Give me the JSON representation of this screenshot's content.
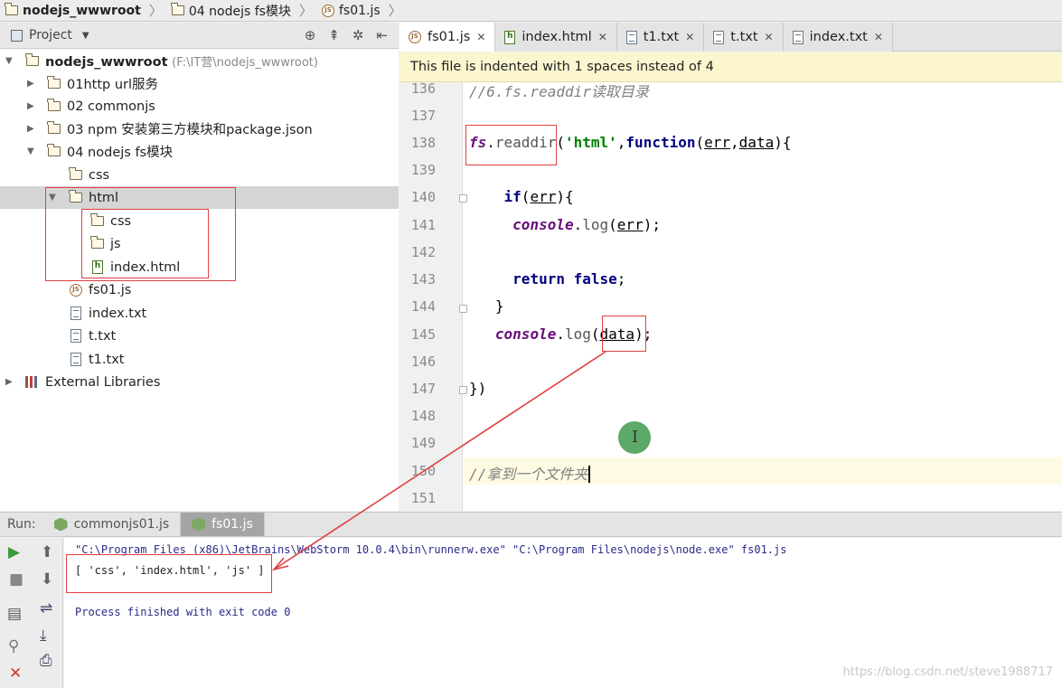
{
  "breadcrumb": [
    "nodejs_wwwroot",
    "04 nodejs fs模块",
    "fs01.js"
  ],
  "project_panel": {
    "title": "Project",
    "root_label": "nodejs_wwwroot",
    "root_path": "(F:\\IT营\\nodejs_wwwroot)",
    "items": [
      "01http url服务",
      "02 commonjs",
      "03 npm 安装第三方模块和package.json",
      "04 nodejs fs模块",
      "css",
      "html",
      "css",
      "js",
      "index.html",
      "fs01.js",
      "index.txt",
      "t.txt",
      "t1.txt",
      "External Libraries"
    ]
  },
  "editor": {
    "tabs": [
      "fs01.js",
      "index.html",
      "t1.txt",
      "t.txt",
      "index.txt"
    ],
    "notice": "This file is indented with 1 spaces instead of 4",
    "line_numbers": [
      "136",
      "137",
      "138",
      "139",
      "140",
      "141",
      "142",
      "143",
      "144",
      "145",
      "146",
      "147",
      "148",
      "149",
      "150",
      "151"
    ],
    "code": {
      "l136": "//6.fs.readdir读取目录",
      "l138_obj": "fs",
      "l138_dot": ".",
      "l138_method": "readdir",
      "l138_open": "(",
      "l138_str": "'html'",
      "l138_comma": ",",
      "l138_kw": "function",
      "l138_p1": "(",
      "l138_err": "err",
      "l138_c2": ",",
      "l138_data": "data",
      "l138_end": "){",
      "l140_kw": "if",
      "l140_p1": "(",
      "l140_err": "err",
      "l140_end": "){",
      "l141_fn": "console",
      "l141_dot": ".",
      "l141_log": "log",
      "l141_p1": "(",
      "l141_err": "err",
      "l141_end": ");",
      "l143_kw": "return false",
      "l143_end": ";",
      "l144": "}",
      "l145_fn": "console",
      "l145_dot": ".",
      "l145_log": "log",
      "l145_p1": "(",
      "l145_data": "data",
      "l145_end": ");",
      "l147": "})",
      "l150": "//拿到一个文件夹"
    }
  },
  "run_panel": {
    "label": "Run:",
    "tabs": [
      "commonjs01.js",
      "fs01.js"
    ],
    "console_lines": [
      "\"C:\\Program Files (x86)\\JetBrains\\WebStorm 10.0.4\\bin\\runnerw.exe\" \"C:\\Program Files\\nodejs\\node.exe\" fs01.js",
      "[ 'css', 'index.html', 'js' ]",
      "Process finished with exit code 0"
    ]
  },
  "watermark": "https://blog.csdn.net/steve1988717",
  "colors": {
    "annotation_red": "#e04040",
    "notice_bg": "#fcf6cf",
    "keyword": "#000080",
    "string": "#008000",
    "comment": "#808080"
  }
}
